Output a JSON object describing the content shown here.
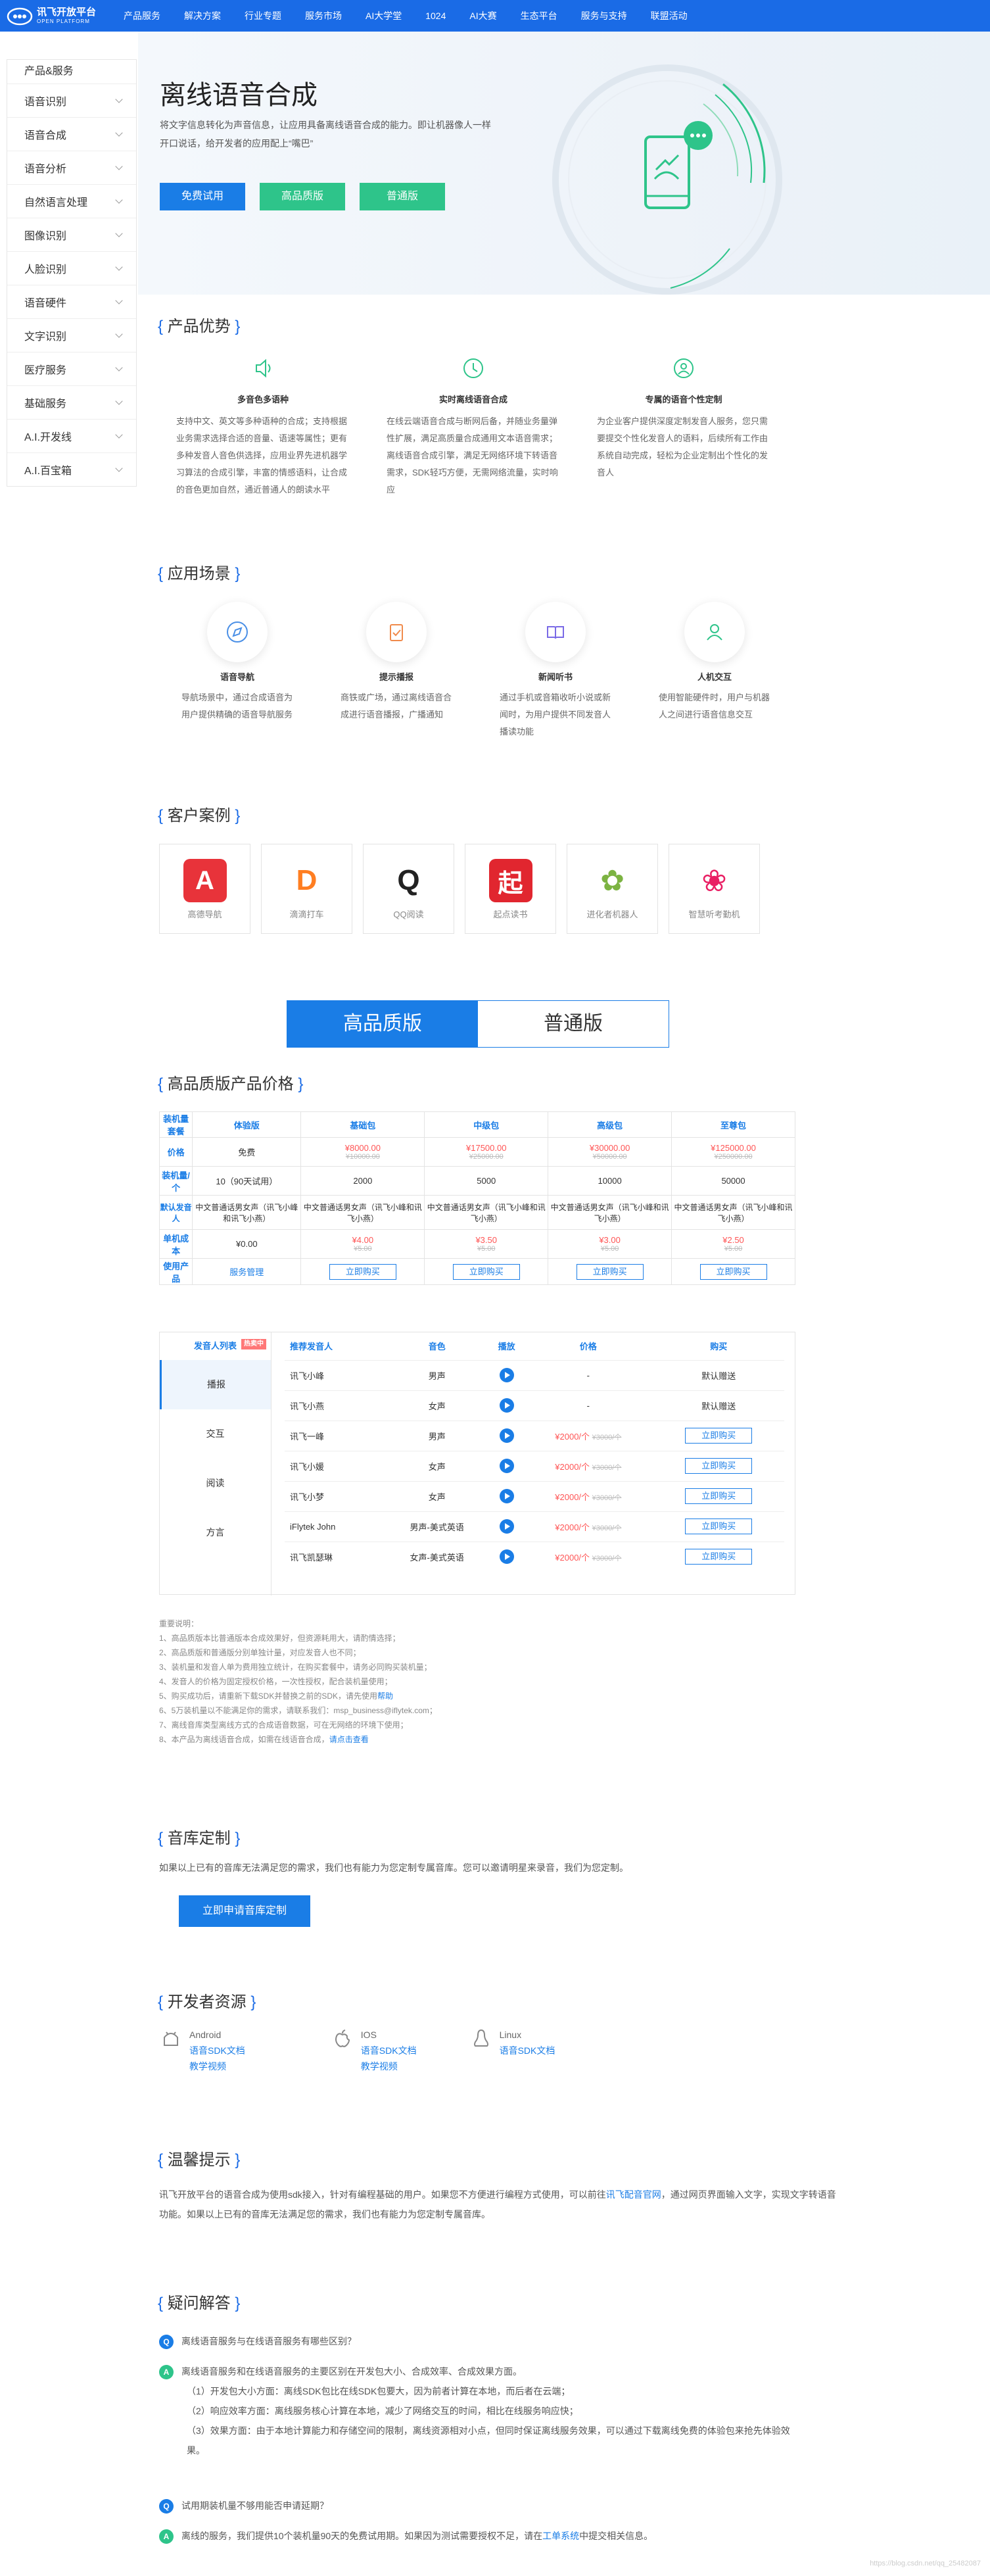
{
  "brand": {
    "name": "讯飞开放平台",
    "sub": "OPEN PLATFORM"
  },
  "nav": [
    "产品服务",
    "解决方案",
    "行业专题",
    "服务市场",
    "AI大学堂",
    "1024",
    "AI大赛",
    "生态平台",
    "服务与支持",
    "联盟活动"
  ],
  "sidebar": {
    "title": "产品&服务",
    "items": [
      "语音识别",
      "语音合成",
      "语音分析",
      "自然语言处理",
      "图像识别",
      "人脸识别",
      "语音硬件",
      "文字识别",
      "医疗服务",
      "基础服务",
      "A.I.开发线",
      "A.I.百宝箱"
    ]
  },
  "hero": {
    "title": "离线语音合成",
    "desc": "将文字信息转化为声音信息，让应用具备离线语音合成的能力。即让机器像人一样开口说话，给开发者的应用配上“嘴巴”",
    "buttons": [
      "免费试用",
      "高品质版",
      "普通版"
    ]
  },
  "advantages": {
    "title": "产品优势",
    "items": [
      {
        "icon": "speaker-icon",
        "name": "多音色多语种",
        "text": "支持中文、英文等多种语种的合成；支持根据业务需求选择合适的音量、语速等属性；更有多种发音人音色供选择，应用业界先进机器学习算法的合成引擎，丰富的情感语料，让合成的音色更加自然，通近普通人的朗读水平"
      },
      {
        "icon": "clock-icon",
        "name": "实时离线语音合成",
        "text": "在线云端语音合成与断网后备，并随业务量弹性扩展，满足高质量合成通用文本语音需求；离线语音合成引擎，满足无网络环境下转语音需求，SDK轻巧方便，无需网络流量，实时响应"
      },
      {
        "icon": "voice-person-icon",
        "name": "专属的语音个性定制",
        "text": "为企业客户提供深度定制发音人服务，您只需要提交个性化发音人的语料，后续所有工作由系统自动完成，轻松为企业定制出个性化的发音人"
      }
    ]
  },
  "scenes": {
    "title": "应用场景",
    "items": [
      {
        "icon": "navigation-icon",
        "name": "语音导航",
        "text": "导航场景中，通过合成语音为用户提供精确的语音导航服务"
      },
      {
        "icon": "clipboard-check-icon",
        "name": "提示播报",
        "text": "商铁或广场，通过离线语音合成进行语音播报，广播通知"
      },
      {
        "icon": "book-icon",
        "name": "新闻听书",
        "text": "通过手机或音箱收听小说或新闻时，为用户提供不同发音人播读功能"
      },
      {
        "icon": "person-icon",
        "name": "人机交互",
        "text": "使用智能硬件时，用户与机器人之间进行语音信息交互"
      }
    ]
  },
  "cases": {
    "title": "客户案例",
    "items": [
      {
        "name": "高德导航",
        "color": "#e8333a",
        "glyph": "A"
      },
      {
        "name": "滴滴打车",
        "color": "#ff7e21",
        "glyph": "D"
      },
      {
        "name": "QQ阅读",
        "color": "#222222",
        "glyph": "Q"
      },
      {
        "name": "起点读书",
        "color": "#e1262f",
        "glyph": "起"
      },
      {
        "name": "进化者机器人",
        "color": "#7cb342",
        "glyph": "✿"
      },
      {
        "name": "智慧听考勤机",
        "color": "#e91e63",
        "glyph": "❀"
      }
    ]
  },
  "tabs": [
    "高品质版",
    "普通版"
  ],
  "pricing": {
    "title": "高品质版产品价格",
    "headers": [
      "装机量套餐",
      "体验版",
      "基础包",
      "中级包",
      "高级包",
      "至尊包"
    ],
    "rows": [
      {
        "label": "价格",
        "cells": [
          "免费",
          {
            "price": "¥8000.00",
            "old": "¥10000.00"
          },
          {
            "price": "¥17500.00",
            "old": "¥25000.00"
          },
          {
            "price": "¥30000.00",
            "old": "¥50000.00"
          },
          {
            "price": "¥125000.00",
            "old": "¥250000.00"
          }
        ]
      },
      {
        "label": "装机量/个",
        "cells": [
          "10（90天试用）",
          "2000",
          "5000",
          "10000",
          "50000"
        ]
      },
      {
        "label": "默认发音人",
        "cells": [
          "中文普通话男女声（讯飞小峰和讯飞小燕）",
          "中文普通话男女声（讯飞小峰和讯飞小燕）",
          "中文普通话男女声（讯飞小峰和讯飞小燕）",
          "中文普通话男女声（讯飞小峰和讯飞小燕）",
          "中文普通话男女声（讯飞小峰和讯飞小燕）"
        ]
      },
      {
        "label": "单机成本",
        "cells": [
          "¥0.00",
          {
            "price": "¥4.00",
            "old": "¥5.00"
          },
          {
            "price": "¥3.50",
            "old": "¥5.00"
          },
          {
            "price": "¥3.00",
            "old": "¥5.00"
          },
          {
            "price": "¥2.50",
            "old": "¥5.00"
          }
        ]
      },
      {
        "label": "使用产品",
        "cells": [
          "服务管理",
          "立即购买",
          "立即购买",
          "立即购买",
          "立即购买"
        ]
      }
    ]
  },
  "voices": {
    "list_title": "发音人列表",
    "badge": "热卖中",
    "categories": [
      "播报",
      "交互",
      "阅读",
      "方言"
    ],
    "headers": [
      "推荐发音人",
      "音色",
      "播放",
      "价格",
      "购买"
    ],
    "rows": [
      {
        "name": "讯飞小峰",
        "timbre": "男声",
        "price": "-",
        "old": "",
        "buy": "默认赠送"
      },
      {
        "name": "讯飞小燕",
        "timbre": "女声",
        "price": "-",
        "old": "",
        "buy": "默认赠送"
      },
      {
        "name": "讯飞一峰",
        "timbre": "男声",
        "price": "¥2000/个",
        "old": "¥3000/个",
        "buy": "立即购买"
      },
      {
        "name": "讯飞小媛",
        "timbre": "女声",
        "price": "¥2000/个",
        "old": "¥3000/个",
        "buy": "立即购买"
      },
      {
        "name": "讯飞小梦",
        "timbre": "女声",
        "price": "¥2000/个",
        "old": "¥3000/个",
        "buy": "立即购买"
      },
      {
        "name": "iFlytek John",
        "timbre": "男声-美式英语",
        "price": "¥2000/个",
        "old": "¥3000/个",
        "buy": "立即购买"
      },
      {
        "name": "讯飞凯瑟琳",
        "timbre": "女声-美式英语",
        "price": "¥2000/个",
        "old": "¥3000/个",
        "buy": "立即购买"
      }
    ]
  },
  "notes": {
    "title": "重要说明：",
    "lines": [
      "1、高品质版本比普通版本合成效果好，但资源耗用大，请酌情选择；",
      "2、高品质版和普通版分别单独计量，对应发音人也不同；",
      "3、装机量和发音人单为费用独立统计，在购买套餐中，请务必同购买装机量；",
      "4、发音人的价格为固定授权价格，一次性授权，配合装机量使用；",
      "5、购买成功后，请重新下载SDK并替换之前的SDK，请先使用",
      "6、5万装机量以不能满足你的需求，请联系我们：msp_business@iflytek.com；",
      "7、离线音库类型离线方式的合成语音数据，可在无网络的环境下使用；",
      "8、本产品为离线语音合成，如需在线语音合成，"
    ],
    "link5": "帮助",
    "link8": "请点击查看"
  },
  "custom": {
    "title": "音库定制",
    "text": "如果以上已有的音库无法满足您的需求，我们也有能力为您定制专属音库。您可以邀请明星来录音，我们为您定制。",
    "button": "立即申请音库定制"
  },
  "dev": {
    "title": "开发者资源",
    "items": [
      {
        "os": "Android",
        "icon": "android-icon",
        "links": [
          "语音SDK文档",
          "教学视频"
        ]
      },
      {
        "os": "IOS",
        "icon": "apple-icon",
        "links": [
          "语音SDK文档",
          "教学视频"
        ]
      },
      {
        "os": "Linux",
        "icon": "linux-icon",
        "links": [
          "语音SDK文档"
        ]
      }
    ]
  },
  "tips": {
    "title": "温馨提示",
    "t1": "讯飞开放平台的语音合成为使用sdk接入，针对有编程基础的用户。如果您不方便进行编程方式使用，可以前往",
    "link": "讯飞配音官网",
    "t2": "，通过网页界面输入文字，实现文字转语音功能。如果以上已有的音库无法满足您的需求，我们也有能力为您定制专属音库。"
  },
  "faq": {
    "title": "疑问解答",
    "q1": "离线语音服务与在线语音服务有哪些区别？",
    "a1": "离线语音服务和在线语音服务的主要区别在开发包大小、合成效率、合成效果方面。",
    "a1_points": [
      "（1）开发包大小方面：离线SDK包比在线SDK包要大，因为前者计算在本地，而后者在云端；",
      "（2）响应效率方面：离线服务核心计算在本地，减少了网络交互的时间，相比在线服务响应快；",
      "（3）效果方面：由于本地计算能力和存储空间的限制，离线资源相对小点，但同时保证离线服务效果，可以通过下载离线免费的体验包来抢先体验效果。"
    ],
    "q2": "试用期装机量不够用能否申请延期？",
    "a2_1": "离线的服务，我们提供10个装机量90天的免费试用期。如果因为测试需要授权不足，请在",
    "a2_link": "工单系统",
    "a2_2": "中提交相关信息。"
  },
  "watermark": "https://blog.csdn.net/qq_25482087"
}
